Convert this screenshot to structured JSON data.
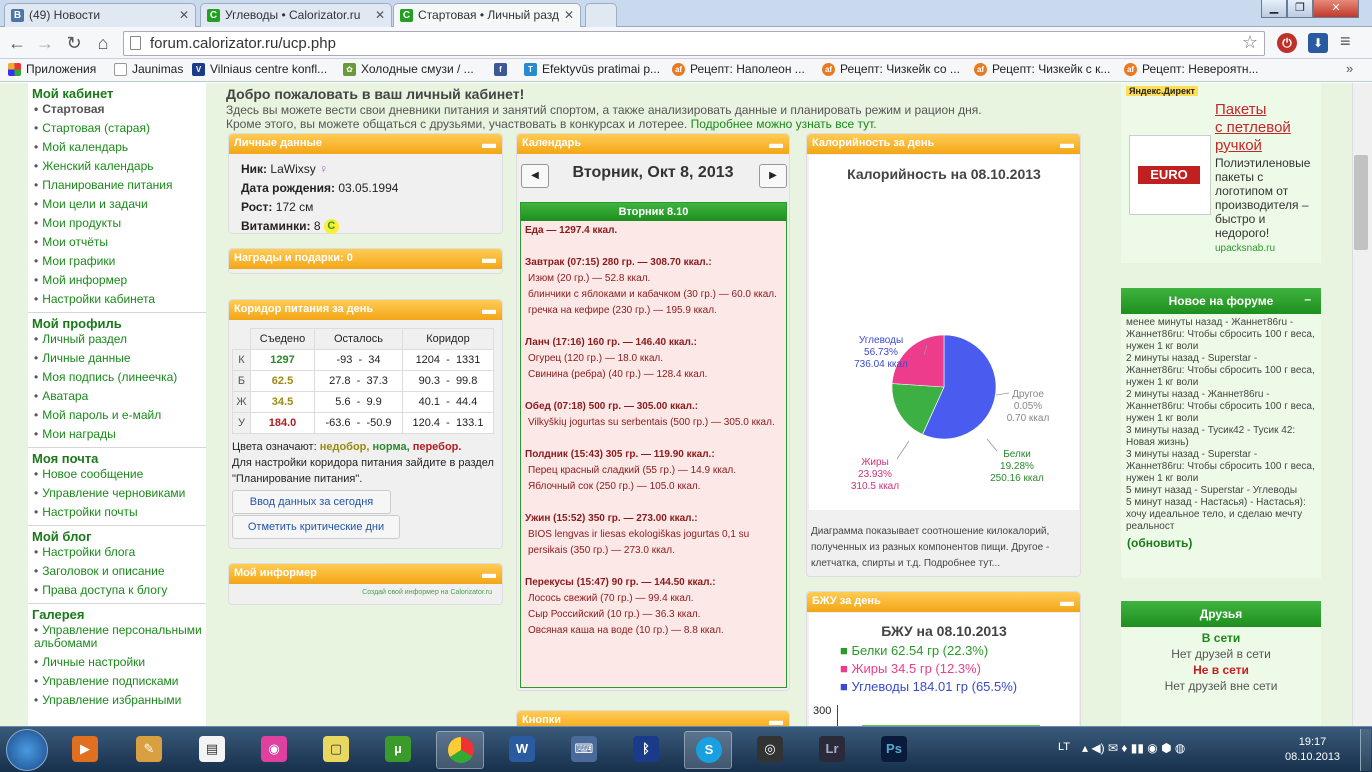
{
  "browser": {
    "tabs": [
      {
        "label": "(49) Новости",
        "icon": "vk-icon"
      },
      {
        "label": "Углеводы • Calorizator.ru",
        "icon": "calorizator-icon"
      },
      {
        "label": "Стартовая • Личный разд",
        "icon": "calorizator-icon"
      }
    ],
    "url": "forum.calorizator.ru/ucp.php",
    "bookmarks": [
      "Приложения",
      "Jaunimas",
      "Vilniaus centre konfl...",
      "Холодные смузи / ...",
      "",
      "Efektyvūs pratimai p...",
      "Рецепт: Наполеон ...",
      "Рецепт: Чизкейк со ...",
      "Рецепт: Чизкейк с к...",
      "Рецепт: Невероятн..."
    ]
  },
  "leftnav": {
    "sections": [
      {
        "title": "Мой кабинет",
        "items": [
          "Стартовая",
          "Стартовая (старая)",
          "Мой календарь",
          "Женский календарь",
          "Планирование питания",
          "Мои цели и задачи",
          "Мои продукты",
          "Мои отчёты",
          "Мои графики",
          "Мой информер",
          "Настройки кабинета"
        ]
      },
      {
        "title": "Мой профиль",
        "items": [
          "Личный раздел",
          "Личные данные",
          "Моя подпись (линеечка)",
          "Аватара",
          "Мой пароль и е-майл",
          "Мои награды"
        ]
      },
      {
        "title": "Моя почта",
        "items": [
          "Новое сообщение",
          "Управление черновиками",
          "Настройки почты"
        ]
      },
      {
        "title": "Мой блог",
        "items": [
          "Настройки блога",
          "Заголовок и описание",
          "Права доступа к блогу"
        ]
      },
      {
        "title": "Галерея",
        "items": [
          "Управление персональными альбомами",
          "Личные настройки",
          "Управление подписками",
          "Управление избранными"
        ]
      }
    ]
  },
  "welcome": {
    "title": "Добро пожаловать в ваш личный кабинет!",
    "line1": "Здесь вы можете вести свои дневники питания и занятий спортом, а также анализировать данные и планировать режим и рацион дня.",
    "line2": "Кроме этого, вы можете общаться с друзьями, участвовать в конкурсах и лотерее.",
    "more_link": "Подробнее можно узнать все тут."
  },
  "personal": {
    "header": "Личные данные",
    "nick_label": "Ник:",
    "nick": "LaWixsy",
    "birth_label": "Дата рождения:",
    "birth": "03.05.1994",
    "height_label": "Рост:",
    "height": "172 см",
    "vit_label": "Витаминки:",
    "vit": "8"
  },
  "awards": {
    "header": "Награды и подарки: 0"
  },
  "corridor": {
    "header": "Коридор питания за день",
    "cols": [
      "Съедено",
      "Осталось",
      "Коридор"
    ],
    "rows": [
      {
        "k": "К",
        "eaten": "1297",
        "left1": "-93",
        "left2": "34",
        "c1": "1204",
        "c2": "1331",
        "color": "#2a8a2a"
      },
      {
        "k": "Б",
        "eaten": "62.5",
        "left1": "27.8",
        "left2": "37.3",
        "c1": "90.3",
        "c2": "99.8",
        "color": "#9a8a10"
      },
      {
        "k": "Ж",
        "eaten": "34.5",
        "left1": "5.6",
        "left2": "9.9",
        "c1": "40.1",
        "c2": "44.4",
        "color": "#9a8a10"
      },
      {
        "k": "У",
        "eaten": "184.0",
        "left1": "-63.6",
        "left2": "-50.9",
        "c1": "120.4",
        "c2": "133.1",
        "color": "#b02020"
      }
    ],
    "legend_prefix": "Цвета означают:",
    "legend_under": "недобор,",
    "legend_norm": "норма,",
    "legend_over": "перебор.",
    "note": "Для настройки коридора питания зайдите в раздел \"Планирование питания\".",
    "btn_enter": "Ввод данных за сегодня",
    "btn_critical": "Отметить критические дни"
  },
  "informer": {
    "header": "Мой информер",
    "link": "Создай свой информер на Calorizator.ru"
  },
  "calendar": {
    "header": "Календарь",
    "date": "Вторник, Окт 8, 2013",
    "day": "Вторник 8.10",
    "total": "Еда — 1297.4 ккал.",
    "meals": [
      {
        "title": "Завтрак (07:15) 280 гр. — 308.70 ккал.:",
        "items": [
          "Изюм (20 гр.) — 52.8 ккал.",
          "блинчики с яблоками и кабачком (30 гр.) — 60.0 ккал.",
          "гречка на кефире (230 гр.) — 195.9 ккал."
        ]
      },
      {
        "title": "Ланч (17:16) 160 гр. — 146.40 ккал.:",
        "items": [
          "Огурец (120 гр.) — 18.0 ккал.",
          "Свинина (ребра) (40 гр.) — 128.4 ккал."
        ]
      },
      {
        "title": "Обед (07:18) 500 гр. — 305.00 ккал.:",
        "items": [
          "Vilkyškių jogurtas su serbentais (500 гр.) — 305.0 ккал."
        ]
      },
      {
        "title": "Полдник (15:43) 305 гр. — 119.90 ккал.:",
        "items": [
          "Перец красный сладкий (55 гр.) — 14.9 ккал.",
          "Яблочный сок (250 гр.) — 105.0 ккал."
        ]
      },
      {
        "title": "Ужин (15:52) 350 гр. — 273.00 ккал.:",
        "items": [
          "BIOS lengvas ir liesas ekologiškas jogurtas 0,1 su persikais (350 гр.) — 273.0 ккал."
        ]
      },
      {
        "title": "Перекусы (15:47) 90 гр. — 144.50 ккал.:",
        "items": [
          "Лосось свежий (70 гр.) — 99.4 ккал.",
          "Сыр Российский (10 гр.) — 36.3 ккал.",
          "Овсяная каша на воде (10 гр.) — 8.8 ккал."
        ]
      }
    ],
    "buttons_header": "Кнопки"
  },
  "calories": {
    "header": "Калорийность за день",
    "title": "Калорийность на 08.10.2013",
    "desc": "Диаграмма показывает соотношение килокалорий, полученных из разных компонентов пищи. Другое - клетчатка, спирты и т.д. Подробнее тут..."
  },
  "bju": {
    "header": "БЖУ за день",
    "title": "БЖУ на 08.10.2013",
    "legend": [
      "Белки 62.54 гр (22.3%)",
      "Жиры 34.5 гр (12.3%)",
      "Углеводы 184.01 гр (65.5%)"
    ],
    "ytick": "300"
  },
  "chart_data": [
    {
      "type": "pie",
      "title": "Калорийность на 08.10.2013",
      "labels": [
        "Углеводы",
        "Белки",
        "Жиры",
        "Другое"
      ],
      "percent": [
        56.73,
        19.28,
        23.93,
        0.05
      ],
      "kcal": [
        736.04,
        250.16,
        310.5,
        0.7
      ],
      "pct_text": [
        "56.73%",
        "19.28%",
        "23.93%",
        "0.05%"
      ],
      "kcal_text": [
        "736.04 ккал",
        "250.16 ккал",
        "310.5 ккал",
        "0.70 ккал"
      ],
      "colors": [
        "#4a5cf0",
        "#3cb043",
        "#ee3c8c",
        "#888888"
      ]
    }
  ],
  "ad": {
    "label": "Яндекс.Директ",
    "title1": "Пакеты",
    "title2": "с петлевой",
    "title3": "ручкой",
    "text": "Полиэтиленовые пакеты с логотипом от производителя – быстро и недорого!",
    "domain": "upacksnab.ru",
    "logo": "EURO"
  },
  "forum": {
    "header": "Новое на форуме",
    "entries": [
      "менее минуты назад - Жаннет86ru - Жаннет86ru: Чтобы сбросить 100 г веса, нужен 1 кг воли",
      "2 минуты назад - Superstar - Жаннет86ru: Чтобы сбросить 100 г веса, нужен 1 кг воли",
      "2 минуты назад - Жаннет86ru - Жаннет86ru: Чтобы сбросить 100 г веса, нужен 1 кг воли",
      "3 минуты назад - Тусик42 - Тусик 42: Новая жизнь)",
      "3 минуты назад - Superstar - Жаннет86ru: Чтобы сбросить 100 г веса, нужен 1 кг воли",
      "5 минут назад - Superstar - Углеводы",
      "5 минут назад - Настасья) - Настасья): хочу идеальное тело, и сделаю мечту реальност"
    ],
    "refresh": "(обновить)"
  },
  "friends": {
    "header": "Друзья",
    "online": "В сети",
    "online_none": "Нет друзей в сети",
    "offline": "Не в сети",
    "offline_none": "Нет друзей вне сети"
  },
  "taskbar": {
    "lang": "LT",
    "time": "19:17",
    "date": "08.10.2013"
  }
}
